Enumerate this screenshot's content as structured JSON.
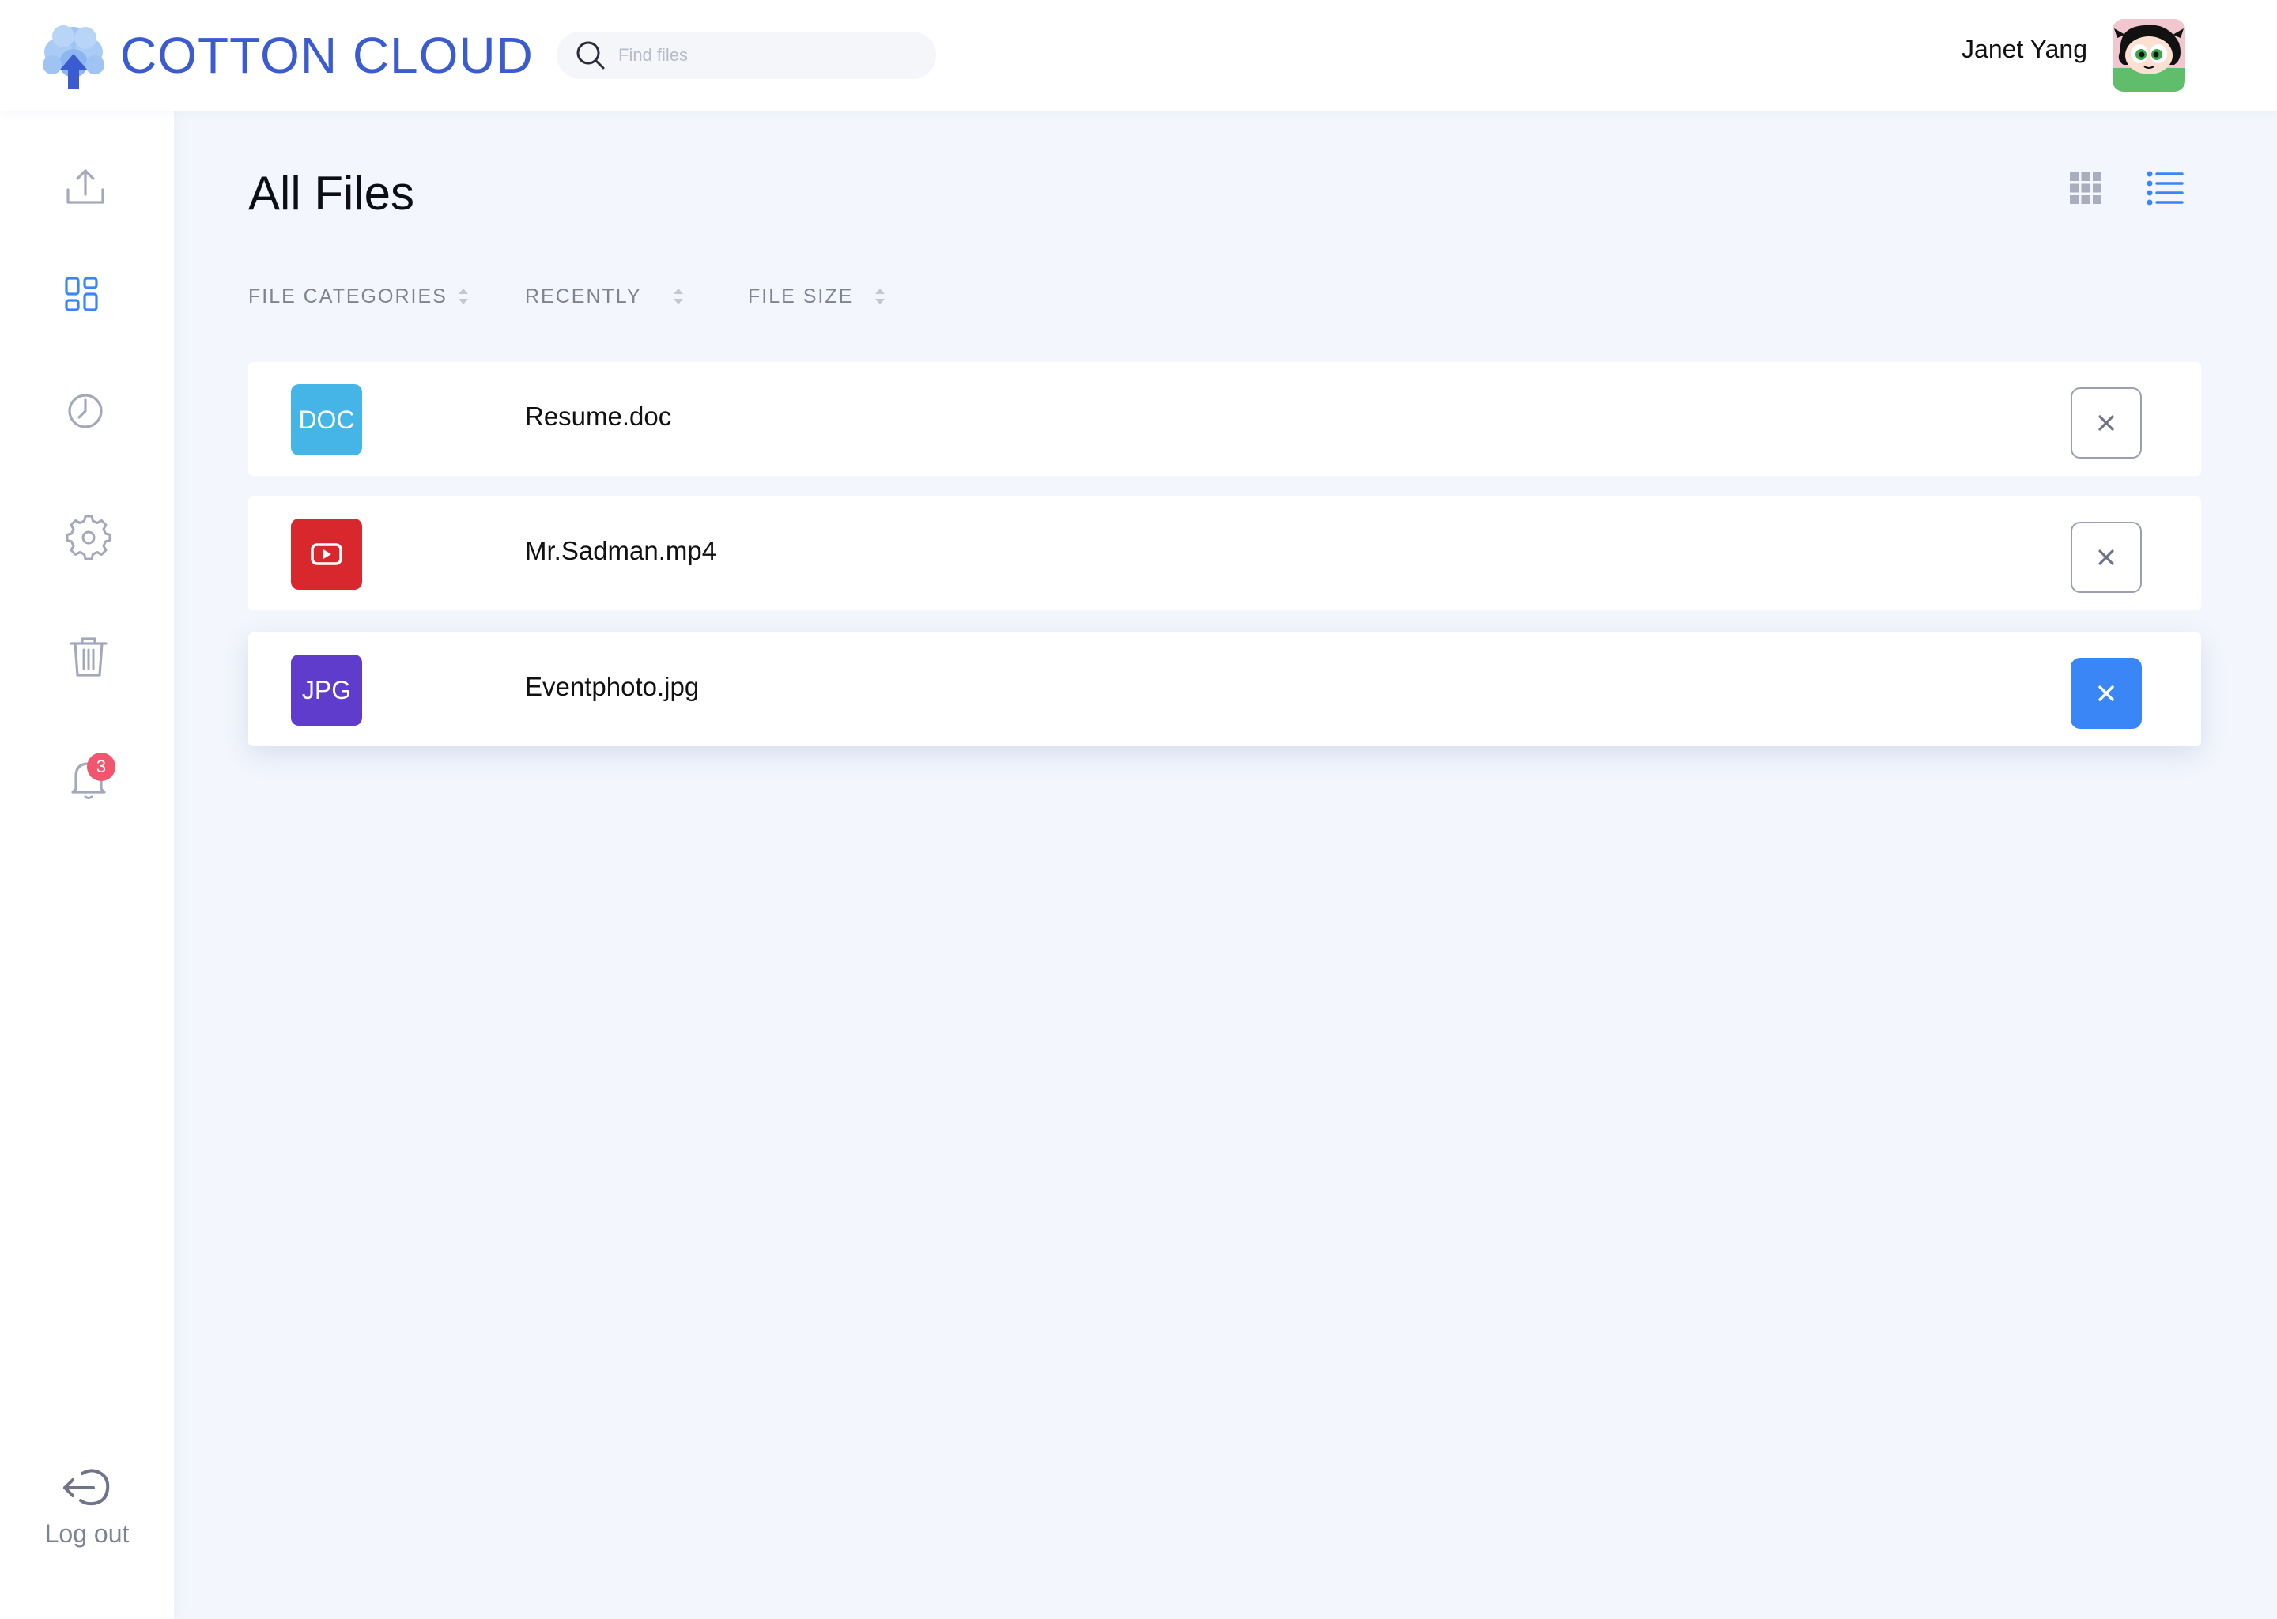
{
  "brand": {
    "name": "COTTON CLOUD",
    "color": "#3b5bd0",
    "icon": "cloud-upload-logo-icon"
  },
  "search": {
    "placeholder": "Find files",
    "icon": "search-icon"
  },
  "user": {
    "name": "Janet Yang",
    "avatar": "user-avatar"
  },
  "sidebar": {
    "items": [
      {
        "id": "upload",
        "icon": "upload-icon"
      },
      {
        "id": "dashboard",
        "icon": "grid-dashboard-icon",
        "active": true
      },
      {
        "id": "recent",
        "icon": "clock-icon"
      },
      {
        "id": "settings",
        "icon": "gear-icon"
      },
      {
        "id": "trash",
        "icon": "trash-icon"
      },
      {
        "id": "notifications",
        "icon": "bell-icon",
        "badge": "3"
      }
    ],
    "logout": {
      "label": "Log out",
      "icon": "logout-icon"
    }
  },
  "main": {
    "title": "All Files",
    "view_modes": [
      {
        "id": "grid",
        "icon": "grid-view-icon",
        "active": false
      },
      {
        "id": "list",
        "icon": "list-view-icon",
        "active": true
      }
    ],
    "sort_columns": [
      {
        "label": "FILE CATEGORIES"
      },
      {
        "label": "RECENTLY"
      },
      {
        "label": "FILE SIZE"
      }
    ],
    "files": [
      {
        "name": "Resume.doc",
        "type_label": "DOC",
        "color": "#45b4e6",
        "delete_icon": "close-icon"
      },
      {
        "name": "Mr.Sadman.mp4",
        "type_label": "",
        "icon": "play-video-icon",
        "color": "#d8272d",
        "delete_icon": "close-icon"
      },
      {
        "name": "Eventphoto.jpg",
        "type_label": "JPG",
        "color": "#5f3ccc",
        "delete_icon": "close-icon",
        "selected": true
      }
    ]
  },
  "colors": {
    "accent": "#3a86f7",
    "background": "#f3f6fd",
    "icon_gray": "#9aa0b4",
    "badge": "#f0566e"
  }
}
